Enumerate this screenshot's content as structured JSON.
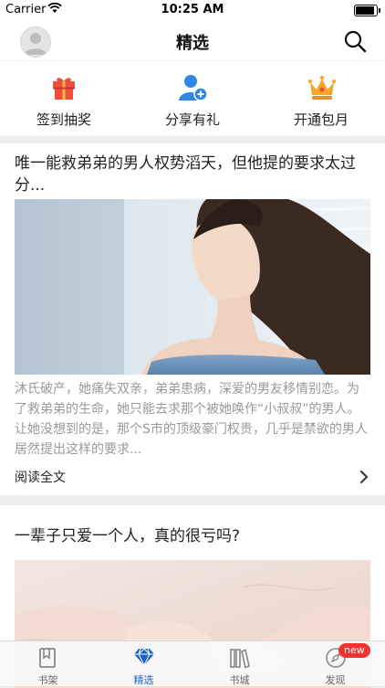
{
  "status_bar": {
    "carrier": "Carrier",
    "time": "10:25 AM"
  },
  "header": {
    "title": "精选"
  },
  "quick_actions": [
    {
      "label": "签到抽奖",
      "icon": "gift-icon"
    },
    {
      "label": "分享有礼",
      "icon": "user-add-icon"
    },
    {
      "label": "开通包月",
      "icon": "crown-icon"
    }
  ],
  "articles": [
    {
      "title": "唯一能救弟弟的男人权势滔天，但他提的要求太过分...",
      "summary": "沐氏破产，她痛失双亲，弟弟患病，深爱的男友移情别恋。为了救弟弟的生命，她只能去求那个被她唤作“小叔叔”的男人。让她没想到的是，那个S市的顶级豪门权贵，几乎是禁欲的男人居然提出这样的要求...",
      "read_more": "阅读全文"
    },
    {
      "title": "一辈子只爱一个人，真的很亏吗?"
    }
  ],
  "tabbar": {
    "items": [
      {
        "label": "书架",
        "icon": "bookshelf-icon"
      },
      {
        "label": "精选",
        "icon": "diamond-icon"
      },
      {
        "label": "书城",
        "icon": "bookstore-icon"
      },
      {
        "label": "发现",
        "icon": "compass-icon"
      }
    ],
    "badge": "new"
  },
  "colors": {
    "accent": "#1a63c9",
    "badge": "#f23131",
    "gift": "#f04e3a",
    "crown": "#f5a623"
  }
}
